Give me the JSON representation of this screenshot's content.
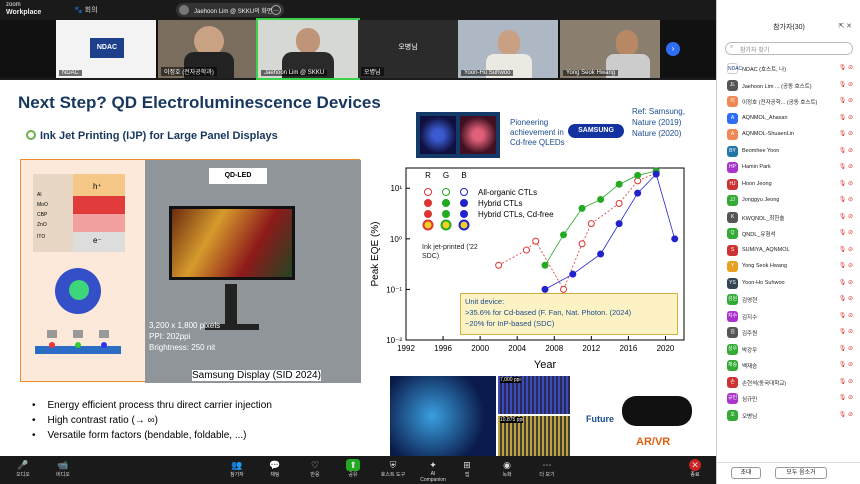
{
  "app": {
    "brand_small": "zoom",
    "brand": "Workplace",
    "meeting": "회의",
    "share_label": "Jaehoon Lim @ SKKU의 화면",
    "view": "보기"
  },
  "tiles": [
    {
      "name": "NDAC",
      "logo": "NDAC"
    },
    {
      "name": "이정호 (전자공학과)"
    },
    {
      "name": "Jaehoon Lim @ SKKU"
    },
    {
      "name": "오병님",
      "center": "오병님"
    },
    {
      "name": "Yoon-Ho Suhwoo"
    },
    {
      "name": "Yong Seok Hwang"
    }
  ],
  "slide": {
    "title": "Next Step? QD Electroluminescence Devices",
    "subtitle": "Ink Jet Printing (IJP) for Large Panel Displays",
    "stack_labels": [
      "h⁺",
      "e⁻",
      "Al",
      "MoO",
      "CBP",
      "ZnO",
      "ITO"
    ],
    "tv_badge": "QD-LED",
    "specs": [
      "3,200 x 1,800 pixels",
      "PPI: 202ppi",
      "Brightness: 250 nit"
    ],
    "caption": "Samsung Display (SID 2024)",
    "bullets": [
      "Energy efficient process thru direct carrier injection",
      "High contrast ratio (→ ∞)",
      "Versatile form factors (bendable, foldable, ...)"
    ],
    "pioneer": "Pioneering achievement in Cd-free QLEDs",
    "samsung": "SAMSUNG",
    "ref1": "Ref: Samsung,",
    "ref2": "Nature (2019)",
    "ref3": "Nature (2020)",
    "ink_label": "Ink jet-printed ('22 SDC)",
    "unit1": "Unit device:",
    "unit2": ">35.6% for Cd-based (F. Fan, Nat. Photon. (2024)",
    "unit3": "~20% for InP-based (SDC)",
    "future": "Future",
    "arvr": "AR/VR",
    "micro1": "7,000 ppi",
    "micro2": "10,875 ppi"
  },
  "chart_data": {
    "type": "scatter",
    "xlabel": "Year",
    "ylabel": "Peak EQE (%)",
    "x_ticks": [
      "1992",
      "1996",
      "2000",
      "2004",
      "2008",
      "2012",
      "2016",
      "2020"
    ],
    "y_ticks": [
      "10¹",
      "10⁰",
      "10⁻¹",
      "10⁻²"
    ],
    "xlim": [
      1992,
      2022
    ],
    "ylim_log10": [
      -2,
      1.4
    ],
    "rgb_header": [
      "R",
      "G",
      "B"
    ],
    "series": [
      {
        "name": "All-organic CTLs",
        "color": "#d33",
        "points": [
          [
            2002,
            0.3
          ],
          [
            2005,
            0.6
          ],
          [
            2006,
            0.9
          ],
          [
            2009,
            0.1
          ],
          [
            2011,
            0.8
          ],
          [
            2012,
            2
          ],
          [
            2015,
            5
          ],
          [
            2017,
            14
          ],
          [
            2019,
            20
          ]
        ]
      },
      {
        "name": "Hybrid CTLs",
        "color": "#2a2",
        "points": [
          [
            2007,
            0.3
          ],
          [
            2009,
            1.2
          ],
          [
            2011,
            4
          ],
          [
            2013,
            6
          ],
          [
            2015,
            12
          ],
          [
            2017,
            18
          ],
          [
            2019,
            22
          ]
        ]
      },
      {
        "name": "Hybrid CTLs, Cd-free",
        "color": "#22c",
        "points": [
          [
            2007,
            0.1
          ],
          [
            2010,
            0.2
          ],
          [
            2013,
            0.5
          ],
          [
            2015,
            2
          ],
          [
            2017,
            8
          ],
          [
            2019,
            19
          ],
          [
            2021,
            1.0
          ]
        ]
      }
    ]
  },
  "toolbar": [
    {
      "l": "오디오"
    },
    {
      "l": "비디오"
    },
    {
      "l": "참가자"
    },
    {
      "l": "채팅"
    },
    {
      "l": "반응"
    },
    {
      "l": "공유"
    },
    {
      "l": "호스트 도구"
    },
    {
      "l": "AI Companion"
    },
    {
      "l": "앱"
    },
    {
      "l": "녹화"
    },
    {
      "l": "더 보기"
    },
    {
      "l": "종료"
    }
  ],
  "panel": {
    "title": "참가자(30)",
    "search": "참가자 찾기",
    "invite": "초대",
    "mute_all": "모두 음소거",
    "people": [
      {
        "n": "NDAC (호스트, 나)",
        "c": "#fff",
        "a": "NDAC"
      },
      {
        "n": "Jaehoon Lim ... (공동 호스트)",
        "c": "#555",
        "a": "JL"
      },
      {
        "n": "이정호 (전자공학... (공동 호스트)",
        "c": "#e85",
        "a": "이"
      },
      {
        "n": "AQNMOL_Ahasan",
        "c": "#2d6ef5",
        "a": "A"
      },
      {
        "n": "AQNMOL-ShuaenLin",
        "c": "#e85",
        "a": "A"
      },
      {
        "n": "Beomhee Yoon",
        "c": "#27a",
        "a": "BY"
      },
      {
        "n": "Hamin Park",
        "c": "#a3c",
        "a": "HP"
      },
      {
        "n": "Hoon Jeong",
        "c": "#c33",
        "a": "HJ"
      },
      {
        "n": "Jonggyu Jeong",
        "c": "#3a3",
        "a": "JJ"
      },
      {
        "n": "KWQNDL_최한솔",
        "c": "#555",
        "a": "K"
      },
      {
        "n": "QNDL_유형석",
        "c": "#3a3",
        "a": "Q"
      },
      {
        "n": "SUMIYA_AQNMOL",
        "c": "#c33",
        "a": "S"
      },
      {
        "n": "Yong Seok Hwang",
        "c": "#e8a020",
        "a": "Y"
      },
      {
        "n": "Yoon-Ho Suhwoo",
        "c": "#345",
        "a": "YS"
      },
      {
        "n": "김영현",
        "c": "#3a3",
        "a": "성원"
      },
      {
        "n": "김지수",
        "c": "#a3c",
        "a": "지수"
      },
      {
        "n": "김주원",
        "c": "#555",
        "a": "김"
      },
      {
        "n": "박강우",
        "c": "#3a3",
        "a": "성우"
      },
      {
        "n": "백재승",
        "c": "#3a3",
        "a": "재승"
      },
      {
        "n": "손현석(동국대학교)",
        "c": "#c33",
        "a": "손"
      },
      {
        "n": "심규민",
        "c": "#a3c",
        "a": "규민"
      },
      {
        "n": "오병님",
        "c": "#3a3",
        "a": "오"
      }
    ]
  }
}
